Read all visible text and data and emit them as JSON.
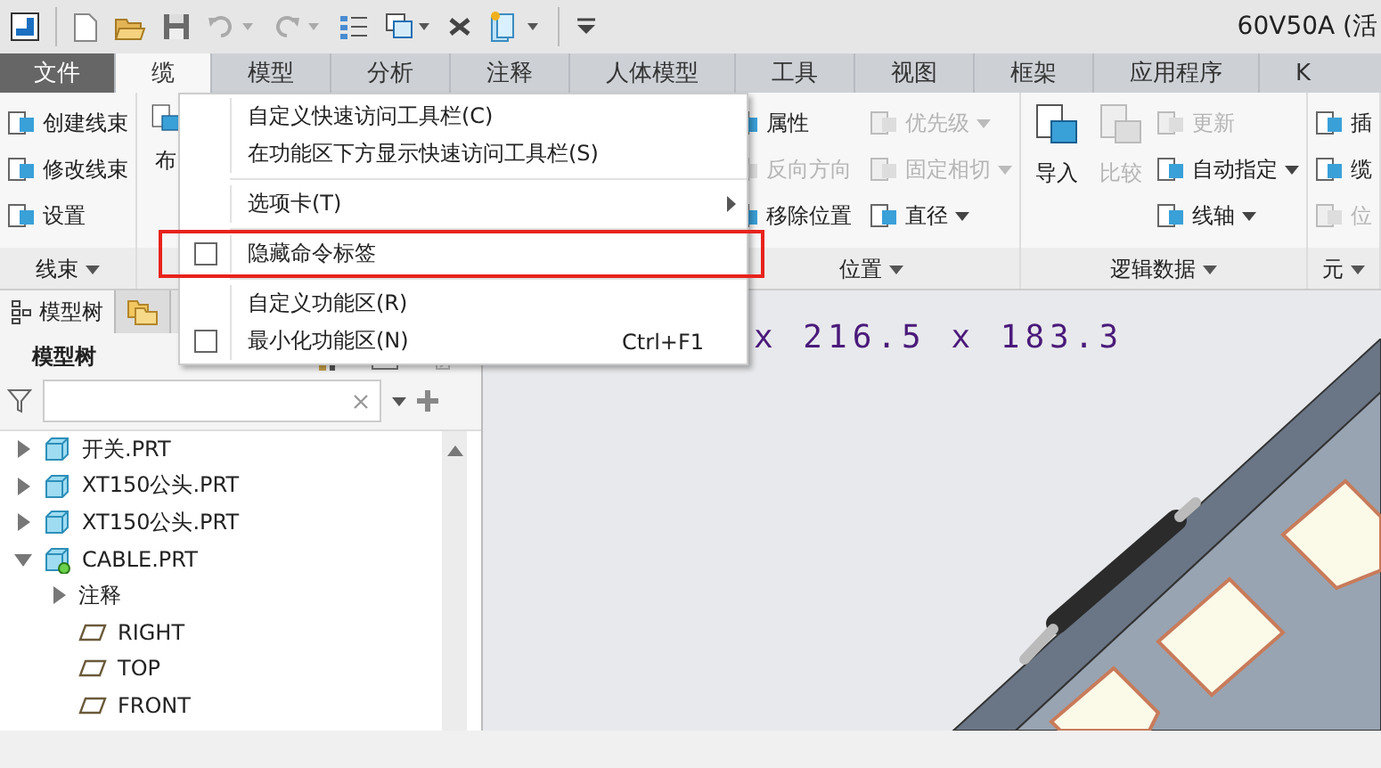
{
  "window": {
    "title": "60V50A (活"
  },
  "tabs": [
    {
      "label": "文件",
      "kind": "file",
      "selected": false
    },
    {
      "label": "缆",
      "kind": "tab",
      "selected": true
    },
    {
      "label": "模型",
      "kind": "tab",
      "selected": false
    },
    {
      "label": "分析",
      "kind": "tab",
      "selected": false
    },
    {
      "label": "注释",
      "kind": "tab",
      "selected": false
    },
    {
      "label": "人体模型",
      "kind": "tab",
      "selected": false
    },
    {
      "label": "工具",
      "kind": "tab",
      "selected": false
    },
    {
      "label": "视图",
      "kind": "tab",
      "selected": false
    },
    {
      "label": "框架",
      "kind": "tab",
      "selected": false
    },
    {
      "label": "应用程序",
      "kind": "tab",
      "selected": false
    },
    {
      "label": "K",
      "kind": "tab",
      "selected": false
    }
  ],
  "ribbon_groups": [
    {
      "label": "线束",
      "items": [
        {
          "kind": "small",
          "label": "创建线束",
          "disabled": false
        },
        {
          "kind": "small",
          "label": "修改线束",
          "disabled": false
        },
        {
          "kind": "small",
          "label": "设置",
          "disabled": false
        }
      ]
    },
    {
      "items": [
        {
          "kind": "large",
          "label": "布",
          "disabled": false
        }
      ]
    },
    {
      "label": "位置",
      "items": [
        {
          "kind": "small",
          "label": "属性",
          "disabled": false
        },
        {
          "kind": "small",
          "label": "反向方向",
          "disabled": true
        },
        {
          "kind": "small",
          "label": "移除位置",
          "disabled": false
        },
        {
          "kind": "small",
          "label": "优先级",
          "disabled": true,
          "dropdown": true
        },
        {
          "kind": "small",
          "label": "固定相切",
          "disabled": true,
          "dropdown": true
        },
        {
          "kind": "small",
          "label": "直径",
          "disabled": false,
          "dropdown": true
        }
      ]
    },
    {
      "label": "逻辑数据",
      "items": [
        {
          "kind": "large",
          "label": "导入",
          "disabled": false
        },
        {
          "kind": "large",
          "label": "比较",
          "disabled": true
        },
        {
          "kind": "small",
          "label": "更新",
          "disabled": true
        },
        {
          "kind": "small",
          "label": "自动指定",
          "disabled": false,
          "dropdown": true
        },
        {
          "kind": "small",
          "label": "线轴",
          "disabled": false,
          "dropdown": true
        }
      ]
    },
    {
      "label": "元",
      "items": [
        {
          "kind": "small",
          "label": "插",
          "disabled": false
        },
        {
          "kind": "small",
          "label": "缆",
          "disabled": false
        },
        {
          "kind": "small",
          "label": "位",
          "disabled": true
        }
      ]
    }
  ],
  "context_menu": {
    "items": [
      {
        "kind": "command",
        "label": "自定义快速访问工具栏(C)",
        "highlighted": false
      },
      {
        "kind": "command",
        "label": "在功能区下方显示快速访问工具栏(S)",
        "highlighted": false
      },
      {
        "kind": "separator"
      },
      {
        "kind": "submenu",
        "label": "选项卡(T)",
        "highlighted": false
      },
      {
        "kind": "separator"
      },
      {
        "kind": "checkbox",
        "label": "隐藏命令标签",
        "checked": false,
        "highlighted": true
      },
      {
        "kind": "separator"
      },
      {
        "kind": "command",
        "label": "自定义功能区(R)",
        "highlighted": false
      },
      {
        "kind": "checkbox",
        "label": "最小化功能区(N)",
        "checked": false,
        "shortcut": "Ctrl+F1",
        "highlighted": false
      }
    ]
  },
  "model_tree": {
    "tabs": [
      {
        "kind": "tree",
        "label": "模型树",
        "selected": true
      },
      {
        "kind": "folder",
        "selected": false
      }
    ],
    "title": "模型树",
    "items": [
      {
        "kind": "part",
        "label": "开关.PRT",
        "expanded": false
      },
      {
        "kind": "part",
        "label": "XT150公头.PRT",
        "expanded": false
      },
      {
        "kind": "part",
        "label": "XT150公头.PRT",
        "expanded": false
      },
      {
        "kind": "active-part",
        "label": "CABLE.PRT",
        "expanded": true,
        "children": [
          {
            "kind": "group",
            "label": "注释",
            "expanded": false
          },
          {
            "kind": "plane",
            "label": "RIGHT"
          },
          {
            "kind": "plane",
            "label": "TOP"
          },
          {
            "kind": "plane",
            "label": "FRONT"
          }
        ]
      }
    ]
  },
  "canvas": {
    "dimension_text": "x 216.5 x 183.3"
  }
}
